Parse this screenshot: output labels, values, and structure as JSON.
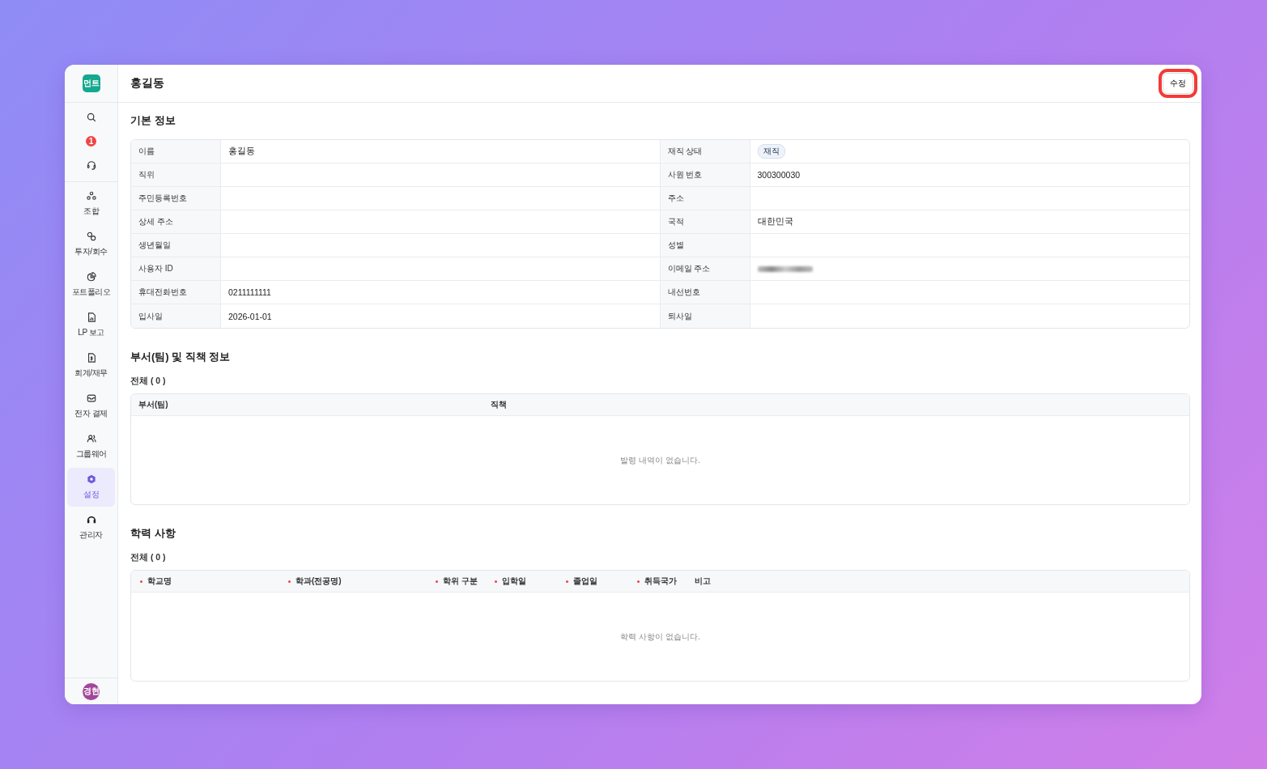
{
  "sidebar": {
    "logo": "먼트",
    "notification_count": "1",
    "items": [
      {
        "label": "조합",
        "selected": false
      },
      {
        "label": "투자/회수",
        "selected": false
      },
      {
        "label": "포트폴리오",
        "selected": false
      },
      {
        "label": "LP 보고",
        "selected": false
      },
      {
        "label": "회계/재무",
        "selected": false
      },
      {
        "label": "전자 결제",
        "selected": false
      },
      {
        "label": "그룹웨어",
        "selected": false
      },
      {
        "label": "설정",
        "selected": true
      },
      {
        "label": "관리자",
        "selected": false
      }
    ],
    "avatar": "경현"
  },
  "header": {
    "title": "홍길동",
    "edit_button": {
      "label": "수정",
      "highlighted": true
    }
  },
  "basic_info": {
    "title": "기본 정보",
    "rows": [
      [
        {
          "label": "이름",
          "value": "홍길동"
        },
        {
          "label": "재직 상태",
          "value": "재직",
          "kind": "tag"
        }
      ],
      [
        {
          "label": "직위"
        },
        {
          "label": "사원 번호",
          "value": "300300030"
        }
      ],
      [
        {
          "label": "주민등록번호"
        },
        {
          "label": "주소"
        }
      ],
      [
        {
          "label": "상세 주소"
        },
        {
          "label": "국적",
          "value": "대한민국"
        }
      ],
      [
        {
          "label": "생년월일"
        },
        {
          "label": "성별"
        }
      ],
      [
        {
          "label": "사용자 ID"
        },
        {
          "label": "이메일 주소",
          "kind": "redacted"
        }
      ],
      [
        {
          "label": "휴대전화번호",
          "value": "0211111111"
        },
        {
          "label": "내선번호"
        }
      ],
      [
        {
          "label": "입사일",
          "value": "2026-01-01"
        },
        {
          "label": "퇴사일"
        }
      ]
    ]
  },
  "sections": [
    {
      "title": "부서(팀) 및 직책 정보",
      "count": "전체 ( 0 )",
      "columns": [
        {
          "label": "부서(팀)",
          "required": false
        },
        {
          "label": "직책",
          "required": false
        }
      ],
      "empty_text": "발령 내역이 없습니다."
    },
    {
      "title": "학력 사항",
      "count": "전체 ( 0 )",
      "columns": [
        {
          "label": "학교명",
          "required": true
        },
        {
          "label": "학과(전공명)",
          "required": true
        },
        {
          "label": "학위 구분",
          "required": true
        },
        {
          "label": "입학일",
          "required": true
        },
        {
          "label": "졸업일",
          "required": true
        },
        {
          "label": "취득국가",
          "required": true
        },
        {
          "label": "비고",
          "required": false
        }
      ],
      "empty_text": "학력 사항이 없습니다."
    }
  ]
}
